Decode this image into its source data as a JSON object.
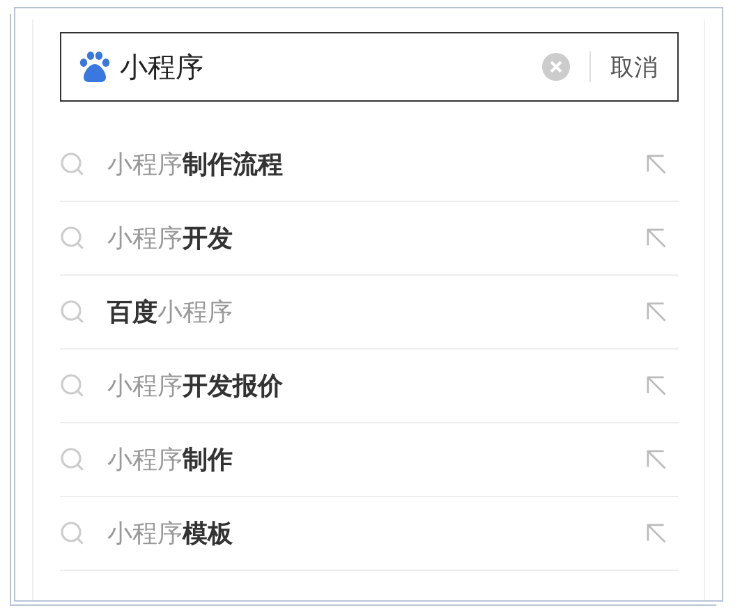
{
  "search": {
    "value": "小程序",
    "cancel": "取消"
  },
  "suggestions": [
    {
      "text": "小程序**制作流程**"
    },
    {
      "text": "小程序**开发**"
    },
    {
      "text": "**百度**小程序"
    },
    {
      "text": "小程序**开发报价**"
    },
    {
      "text": "小程序**制作**"
    },
    {
      "text": "小程序**模板**"
    }
  ]
}
